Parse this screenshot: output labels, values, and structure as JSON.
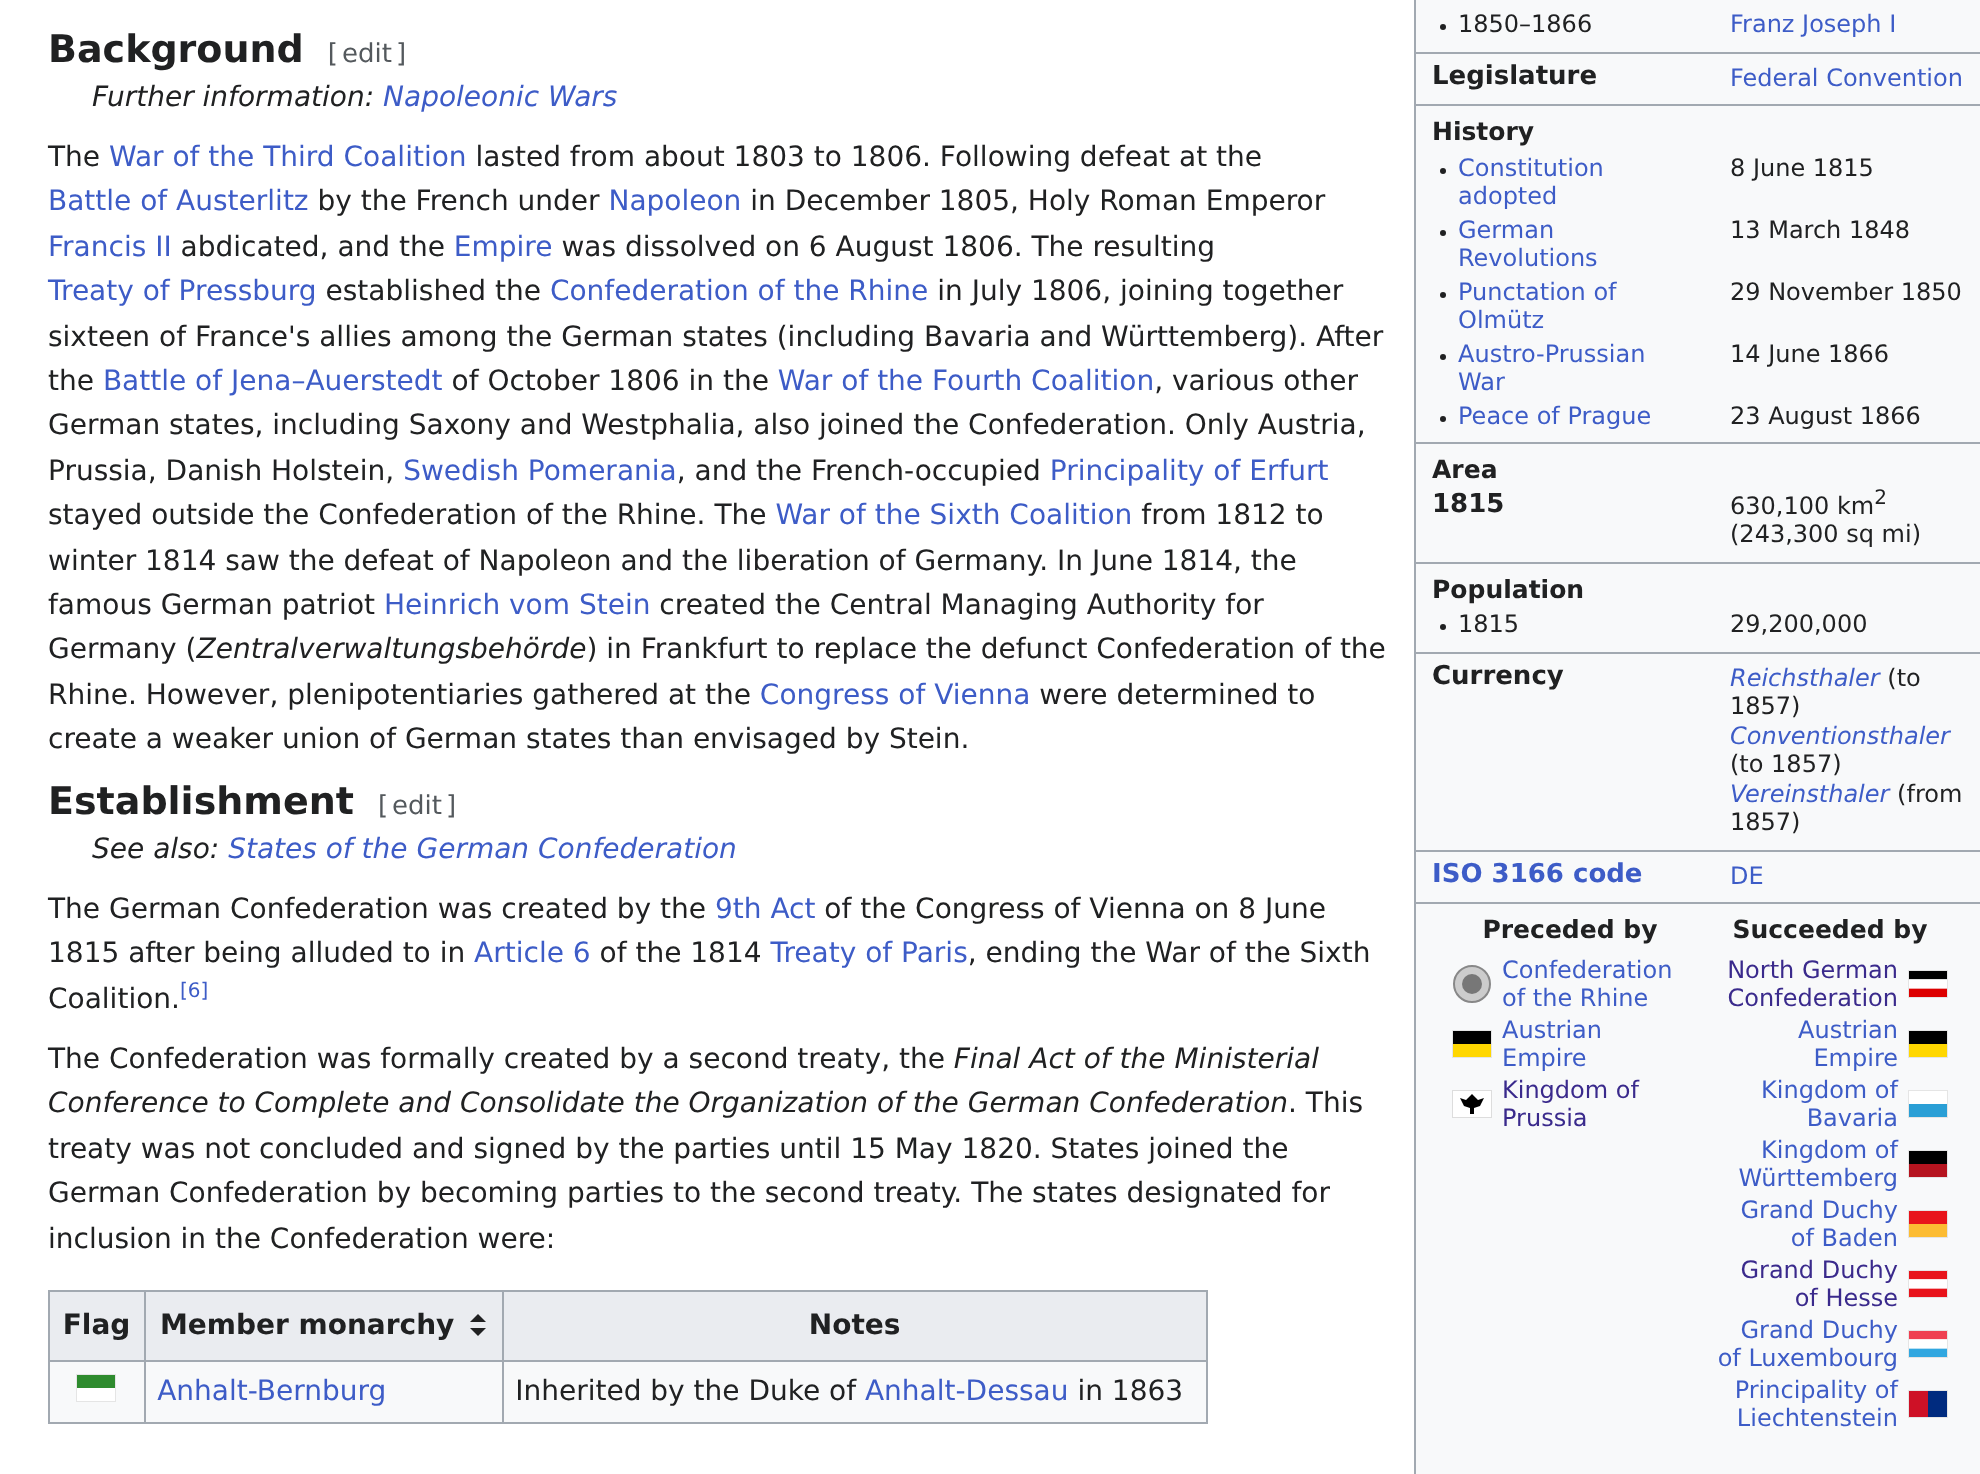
{
  "article": {
    "sections": [
      {
        "heading": "Background",
        "edit": {
          "open": "[",
          "label": "edit",
          "close": "]"
        },
        "hatnote": [
          {
            "kind": "text",
            "text": "Further information: "
          },
          {
            "kind": "link",
            "text": "Napoleonic Wars"
          }
        ],
        "paragraphs": [
          [
            {
              "kind": "text",
              "text": "The "
            },
            {
              "kind": "link",
              "text": "War of the Third Coalition"
            },
            {
              "kind": "text",
              "text": " lasted from about 1803 to 1806. Following defeat at the "
            },
            {
              "kind": "link",
              "text": "Battle of Austerlitz"
            },
            {
              "kind": "text",
              "text": " by the French under "
            },
            {
              "kind": "link",
              "text": "Napoleon"
            },
            {
              "kind": "text",
              "text": " in December 1805, Holy Roman Emperor "
            },
            {
              "kind": "link",
              "text": "Francis II"
            },
            {
              "kind": "text",
              "text": " abdicated, and the "
            },
            {
              "kind": "link",
              "text": "Empire"
            },
            {
              "kind": "text",
              "text": " was dissolved on 6 August 1806. The resulting "
            },
            {
              "kind": "link",
              "text": "Treaty of Pressburg"
            },
            {
              "kind": "text",
              "text": " established the "
            },
            {
              "kind": "link",
              "text": "Confederation of the Rhine"
            },
            {
              "kind": "text",
              "text": " in July 1806, joining together sixteen of France's allies among the German states (including Bavaria and Württemberg). After the "
            },
            {
              "kind": "link",
              "text": "Battle of Jena–Auerstedt"
            },
            {
              "kind": "text",
              "text": " of October 1806 in the "
            },
            {
              "kind": "link",
              "text": "War of the Fourth Coalition"
            },
            {
              "kind": "text",
              "text": ", various other German states, including Saxony and Westphalia, also joined the Confederation. Only Austria, Prussia, Danish Holstein, "
            },
            {
              "kind": "link",
              "text": "Swedish Pomerania"
            },
            {
              "kind": "text",
              "text": ", and the French-occupied "
            },
            {
              "kind": "link",
              "text": "Principality of Erfurt"
            },
            {
              "kind": "text",
              "text": " stayed outside the Confederation of the Rhine. The "
            },
            {
              "kind": "link",
              "text": "War of the Sixth Coalition"
            },
            {
              "kind": "text",
              "text": " from 1812 to winter 1814 saw the defeat of Napoleon and the liberation of Germany. In June 1814, the famous German patriot "
            },
            {
              "kind": "link",
              "text": "Heinrich vom Stein"
            },
            {
              "kind": "text",
              "text": " created the Central Managing Authority for Germany ("
            },
            {
              "kind": "italic",
              "text": "Zentralverwaltungsbehörde"
            },
            {
              "kind": "text",
              "text": ") in Frankfurt to replace the defunct Confederation of the Rhine. However, plenipotentiaries gathered at the "
            },
            {
              "kind": "link",
              "text": "Congress of Vienna"
            },
            {
              "kind": "text",
              "text": " were determined to create a weaker union of German states than envisaged by Stein."
            }
          ]
        ]
      },
      {
        "heading": "Establishment",
        "edit": {
          "open": "[",
          "label": "edit",
          "close": "]"
        },
        "hatnote": [
          {
            "kind": "text",
            "text": "See also: "
          },
          {
            "kind": "link",
            "text": "States of the German Confederation"
          }
        ],
        "paragraphs": [
          [
            {
              "kind": "text",
              "text": "The German Confederation was created by the "
            },
            {
              "kind": "link",
              "text": "9th Act"
            },
            {
              "kind": "text",
              "text": " of the Congress of Vienna on 8 June 1815 after being alluded to in "
            },
            {
              "kind": "link",
              "text": "Article 6"
            },
            {
              "kind": "text",
              "text": " of the 1814 "
            },
            {
              "kind": "link",
              "text": "Treaty of Paris"
            },
            {
              "kind": "text",
              "text": ", ending the War of the Sixth Coalition."
            },
            {
              "kind": "ref",
              "text": "[6]"
            }
          ],
          [
            {
              "kind": "text",
              "text": "The Confederation was formally created by a second treaty, the "
            },
            {
              "kind": "italic",
              "text": "Final Act of the Ministerial Conference to Complete and Consolidate the Organization of the German Confederation"
            },
            {
              "kind": "text",
              "text": ". This treaty was not concluded and signed by the parties until 15 May 1820. States joined the German Confederation by becoming parties to the second treaty. The states designated for inclusion in the Confederation were:"
            }
          ]
        ]
      }
    ],
    "table": {
      "columns": [
        {
          "label": "Flag",
          "sortable": false
        },
        {
          "label": "Member monarchy",
          "sortable": true
        },
        {
          "label": "Notes",
          "sortable": false
        }
      ],
      "rows": [
        {
          "flag": {
            "kind": "horizontal",
            "stripes": [
              {
                "color": "#2e8b2e"
              },
              {
                "color": "#ffffff"
              }
            ]
          },
          "name": "Anhalt-Bernburg",
          "notes": [
            {
              "kind": "text",
              "text": "Inherited by the Duke of "
            },
            {
              "kind": "link",
              "text": "Anhalt-Dessau"
            },
            {
              "kind": "text",
              "text": " in 1863"
            }
          ]
        }
      ]
    }
  },
  "infobox": {
    "sections": [
      {
        "rows": [
          {
            "kind": "bullet",
            "label": [
              {
                "kind": "text",
                "text": "1850–1866"
              }
            ],
            "value": [
              {
                "kind": "link",
                "text": "Franz Joseph I"
              }
            ]
          }
        ]
      },
      {
        "rows": [
          {
            "kind": "head",
            "label": [
              {
                "kind": "text",
                "text": "Legislature"
              }
            ],
            "value": [
              {
                "kind": "link",
                "text": "Federal Convention"
              }
            ]
          }
        ]
      },
      {
        "title": "History",
        "rows": [
          {
            "kind": "bullet",
            "label": [
              {
                "kind": "link",
                "text": "Constitution adopted"
              }
            ],
            "value": [
              {
                "kind": "text",
                "text": "8 June 1815"
              }
            ]
          },
          {
            "kind": "bullet",
            "label": [
              {
                "kind": "link",
                "text": "German Revolutions"
              }
            ],
            "value": [
              {
                "kind": "text",
                "text": "13 March 1848"
              }
            ]
          },
          {
            "kind": "bullet",
            "label": [
              {
                "kind": "link",
                "text": "Punctation of Olmütz"
              }
            ],
            "value": [
              {
                "kind": "text",
                "text": "29 November 1850"
              }
            ]
          },
          {
            "kind": "bullet",
            "label": [
              {
                "kind": "link",
                "text": "Austro-Prussian War"
              }
            ],
            "value": [
              {
                "kind": "text",
                "text": "14 June 1866"
              }
            ]
          },
          {
            "kind": "bullet",
            "label": [
              {
                "kind": "link",
                "text": "Peace of Prague"
              }
            ],
            "value": [
              {
                "kind": "text",
                "text": "23 August 1866"
              }
            ]
          }
        ]
      },
      {
        "title": "Area",
        "rows": [
          {
            "kind": "head",
            "label": [
              {
                "kind": "text",
                "text": "1815"
              }
            ],
            "value": [
              {
                "kind": "text",
                "text": "630,100 km"
              },
              {
                "kind": "sup",
                "text": "2"
              },
              {
                "kind": "text",
                "text": " (243,300 sq mi)"
              }
            ]
          }
        ]
      },
      {
        "title": "Population",
        "rows": [
          {
            "kind": "bullet",
            "label": [
              {
                "kind": "text",
                "text": "1815"
              }
            ],
            "value": [
              {
                "kind": "text",
                "text": "29,200,000"
              }
            ]
          }
        ]
      },
      {
        "rows": [
          {
            "kind": "head",
            "label": [
              {
                "kind": "text",
                "text": "Currency"
              }
            ],
            "value": [
              {
                "kind": "italic-link",
                "text": "Reichsthaler"
              },
              {
                "kind": "text",
                "text": " (to 1857) "
              },
              {
                "kind": "italic-link",
                "text": "Conventionsthaler"
              },
              {
                "kind": "text",
                "text": " (to 1857) "
              },
              {
                "kind": "italic-link",
                "text": "Vereinsthaler"
              },
              {
                "kind": "text",
                "text": " (from 1857)"
              }
            ]
          }
        ]
      },
      {
        "rows": [
          {
            "kind": "head",
            "label": [
              {
                "kind": "link",
                "text": "ISO 3166 code"
              }
            ],
            "value": [
              {
                "kind": "link",
                "text": "DE"
              }
            ]
          }
        ]
      }
    ],
    "succession": {
      "preceded_title": "Preceded by",
      "succeeded_title": "Succeeded by",
      "preceded": [
        {
          "name": "Confederation of the Rhine",
          "visited": false,
          "flag": {
            "kind": "seal",
            "stripes": [
              {
                "color": "#cccccc"
              }
            ]
          }
        },
        {
          "name": "Austrian Empire",
          "visited": false,
          "flag": {
            "kind": "horizontal",
            "stripes": [
              {
                "color": "#000000"
              },
              {
                "color": "#ffd700"
              }
            ]
          }
        },
        {
          "name": "Kingdom of Prussia",
          "visited": true,
          "flag": {
            "kind": "eagle",
            "stripes": [
              {
                "color": "#ffffff"
              },
              {
                "color": "#000000"
              }
            ]
          }
        }
      ],
      "succeeded": [
        {
          "name": "North German Confederation",
          "visited": true,
          "flag": {
            "kind": "horizontal",
            "stripes": [
              {
                "color": "#000000"
              },
              {
                "color": "#ffffff"
              },
              {
                "color": "#dd0000"
              }
            ]
          }
        },
        {
          "name": "Austrian Empire",
          "visited": false,
          "flag": {
            "kind": "horizontal",
            "stripes": [
              {
                "color": "#000000"
              },
              {
                "color": "#ffd700"
              }
            ]
          }
        },
        {
          "name": "Kingdom of Bavaria",
          "visited": false,
          "flag": {
            "kind": "horizontal",
            "stripes": [
              {
                "color": "#ffffff"
              },
              {
                "color": "#2a9fd6"
              }
            ]
          }
        },
        {
          "name": "Kingdom of Württemberg",
          "visited": false,
          "flag": {
            "kind": "horizontal",
            "stripes": [
              {
                "color": "#000000"
              },
              {
                "color": "#b5141f"
              }
            ]
          }
        },
        {
          "name": "Grand Duchy of Baden",
          "visited": false,
          "flag": {
            "kind": "horizontal",
            "stripes": [
              {
                "color": "#e8141b"
              },
              {
                "color": "#fcbc33"
              }
            ]
          }
        },
        {
          "name": "Grand Duchy of Hesse",
          "visited": true,
          "flag": {
            "kind": "horizontal",
            "stripes": [
              {
                "color": "#e8141b"
              },
              {
                "color": "#ffffff"
              },
              {
                "color": "#e8141b"
              }
            ]
          }
        },
        {
          "name": "Grand Duchy of Luxembourg",
          "visited": false,
          "flag": {
            "kind": "horizontal",
            "stripes": [
              {
                "color": "#ef4051"
              },
              {
                "color": "#ffffff"
              },
              {
                "color": "#31a7e0"
              }
            ]
          }
        },
        {
          "name": "Principality of Liechtenstein",
          "visited": false,
          "flag": {
            "kind": "vertical",
            "stripes": [
              {
                "color": "#ce1126"
              },
              {
                "color": "#002b7f"
              }
            ]
          }
        }
      ]
    }
  }
}
